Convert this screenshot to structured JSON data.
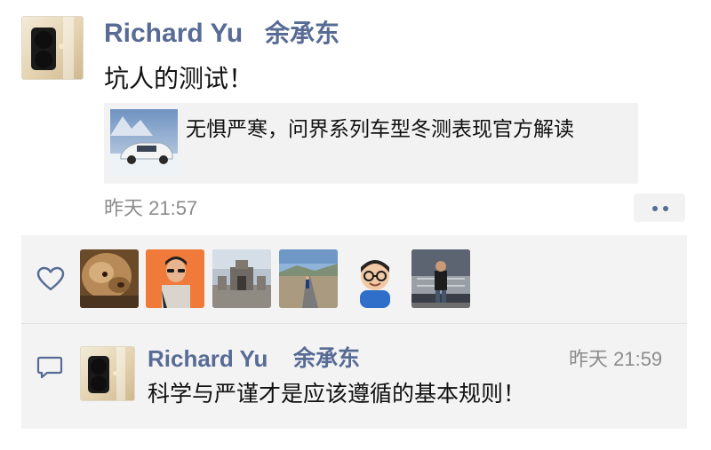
{
  "post": {
    "author_name": "Richard Yu",
    "author_name_cn": "余承东",
    "text": "坑人的测试！",
    "link": {
      "title": "无惧严寒，问界系列车型冬测表现官方解读",
      "thumbnail_icon": "suv-in-snow-thumbnail"
    },
    "time": "昨天 21:57",
    "actions_icon": "more-dots-icon"
  },
  "likes": {
    "icon": "heart-icon",
    "avatars": [
      {
        "name": "alpaca-avatar"
      },
      {
        "name": "man-sunglasses-avatar"
      },
      {
        "name": "stone-ruins-avatar"
      },
      {
        "name": "road-landscape-avatar"
      },
      {
        "name": "memoji-glasses-avatar"
      },
      {
        "name": "man-standing-avatar"
      }
    ]
  },
  "comments": {
    "icon": "comment-icon",
    "items": [
      {
        "author_name": "Richard Yu",
        "author_name_cn": "余承东",
        "time": "昨天 21:59",
        "text": "科学与严谨才是应该遵循的基本规则！"
      }
    ]
  },
  "colors": {
    "name_link": "#576b95",
    "meta_gray": "#8c8c8c",
    "panel_bg": "#f3f3f3"
  }
}
